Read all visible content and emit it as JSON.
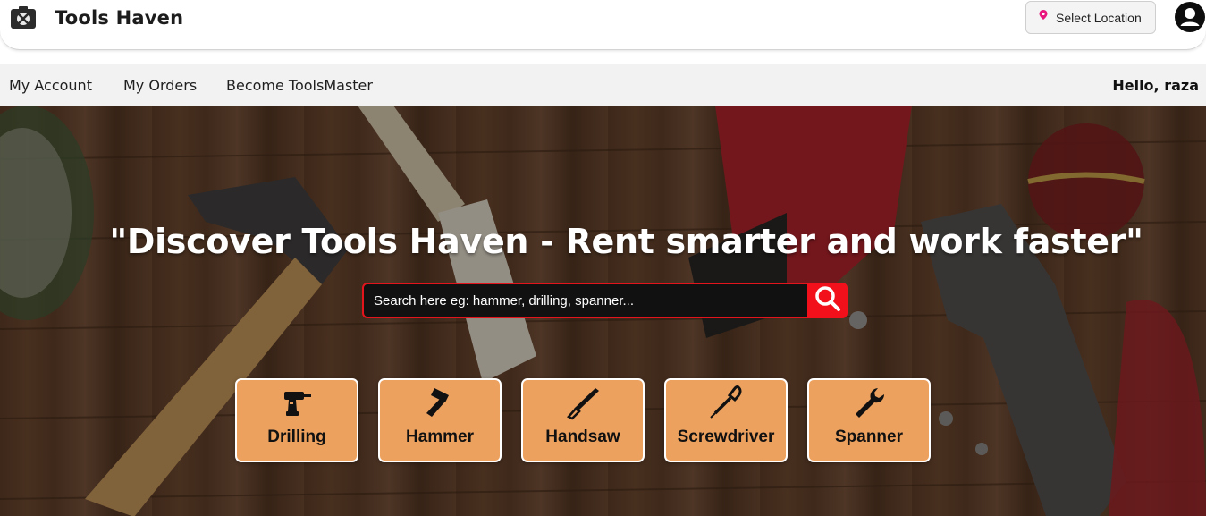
{
  "header": {
    "brand": "Tools Haven",
    "logo_icon": "toolbox-logo-icon",
    "location_button": "Select Location",
    "location_icon": "map-pin-icon",
    "profile_icon": "user-avatar-icon"
  },
  "nav": {
    "links": [
      "My Account",
      "My Orders",
      "Become ToolsMaster"
    ],
    "greeting": "Hello, raza"
  },
  "hero": {
    "headline": "\"Discover Tools Haven - Rent smarter and work faster\"",
    "search": {
      "placeholder": "Search here eg: hammer, drilling, spanner...",
      "button_icon": "search-icon",
      "accent": "#f2111b"
    },
    "categories": [
      {
        "label": "Drilling",
        "icon": "drill-icon"
      },
      {
        "label": "Hammer",
        "icon": "hammer-icon"
      },
      {
        "label": "Handsaw",
        "icon": "handsaw-icon"
      },
      {
        "label": "Screwdriver",
        "icon": "screwdriver-icon"
      },
      {
        "label": "Spanner",
        "icon": "wrench-icon"
      }
    ],
    "category_color": "#eda15e"
  }
}
